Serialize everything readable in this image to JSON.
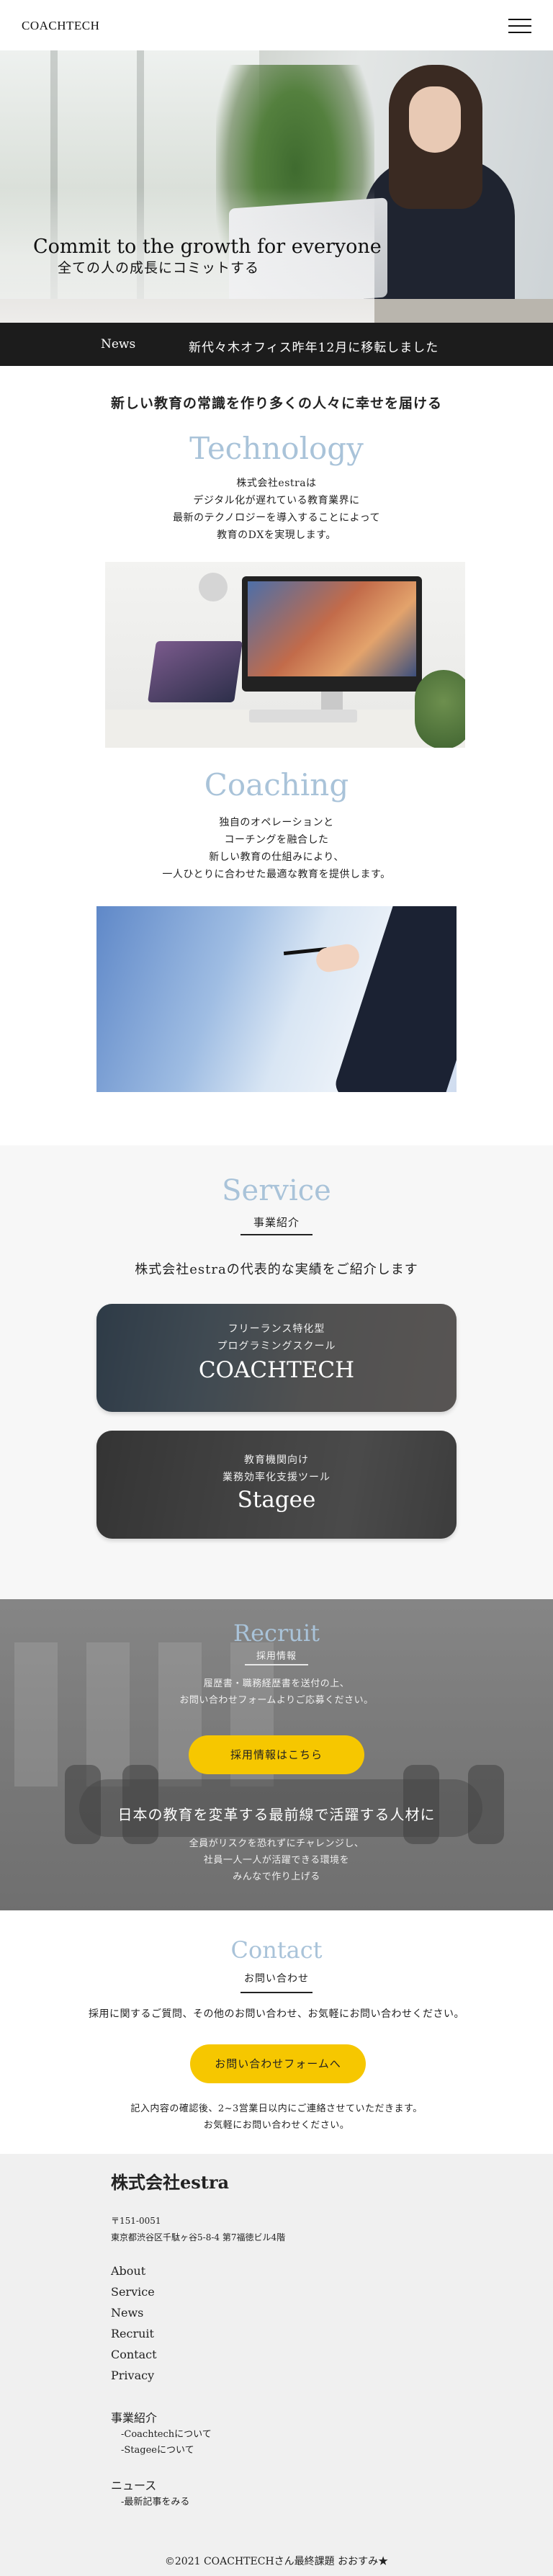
{
  "header": {
    "logo": "COACHTECH"
  },
  "hero": {
    "title": "Commit to the growth for everyone",
    "subtitle": "全ての人の成長にコミットする"
  },
  "news_bar": {
    "label": "News",
    "text": "新代々木オフィス昨年12月に移転しました"
  },
  "intro": {
    "lead": "新しい教育の常識を作り多くの人々に幸せを届ける"
  },
  "technology": {
    "heading": "Technology",
    "lines": [
      "株式会社estraは",
      "デジタル化が遅れている教育業界に",
      "最新のテクノロジーを導入することによって",
      "教育のDXを実現します。"
    ]
  },
  "coaching": {
    "heading": "Coaching",
    "lines": [
      "独自のオペレーションと",
      "コーチングを融合した",
      "新しい教育の仕組みにより、",
      "一人ひとりに合わせた最適な教育を提供します。"
    ]
  },
  "service": {
    "heading": "Service",
    "subheading": "事業紹介",
    "lead": "株式会社estraの代表的な実績をご紹介します",
    "cards": [
      {
        "line1": "フリーランス特化型",
        "line2": "プログラミングスクール",
        "name": "COACHTECH"
      },
      {
        "line1": "教育機関向け",
        "line2": "業務効率化支援ツール",
        "name": "Stagee"
      }
    ]
  },
  "recruit": {
    "heading": "Recruit",
    "subheading": "採用情報",
    "lines": [
      "履歴書・職務経歴書を送付の上、",
      "お問い合わせフォームよりご応募ください。"
    ],
    "button": "採用情報はこちら",
    "lead": "日本の教育を変革する最前線で活躍する人材に",
    "lines2": [
      "全員がリスクを恐れずにチャレンジし、",
      "社員一人一人が活躍できる環境を",
      "みんなで作り上げる"
    ]
  },
  "contact": {
    "heading": "Contact",
    "subheading": "お問い合わせ",
    "lead": "採用に関するご質問、その他のお問い合わせ、お気軽にお問い合わせください。",
    "button": "お問い合わせフォームへ",
    "notes": [
      "記入内容の確認後、2~3営業日以内にご連絡させていただきます。",
      "お気軽にお問い合わせください。"
    ]
  },
  "footer": {
    "company": "株式会社estra",
    "postal": "〒151-0051",
    "address": "東京都渋谷区千駄ヶ谷5-8-4 第7福徳ビル4階",
    "links": [
      "About",
      "Service",
      "News",
      "Recruit",
      "Contact",
      "Privacy"
    ],
    "service_heading": "事業紹介",
    "service_links": [
      "-Coachtechについて",
      "-Stageeについて"
    ],
    "news_heading": "ニュース",
    "news_links": [
      "-最新記事をみる"
    ],
    "copyright": "©2021 COACHTECHさん最終課題 おおすみ★"
  },
  "colors": {
    "accent_heading": "#a9c3d9",
    "button_yellow": "#f6c700",
    "news_bar_bg": "#1c1c1c",
    "footer_bg": "#f0f0f0"
  }
}
